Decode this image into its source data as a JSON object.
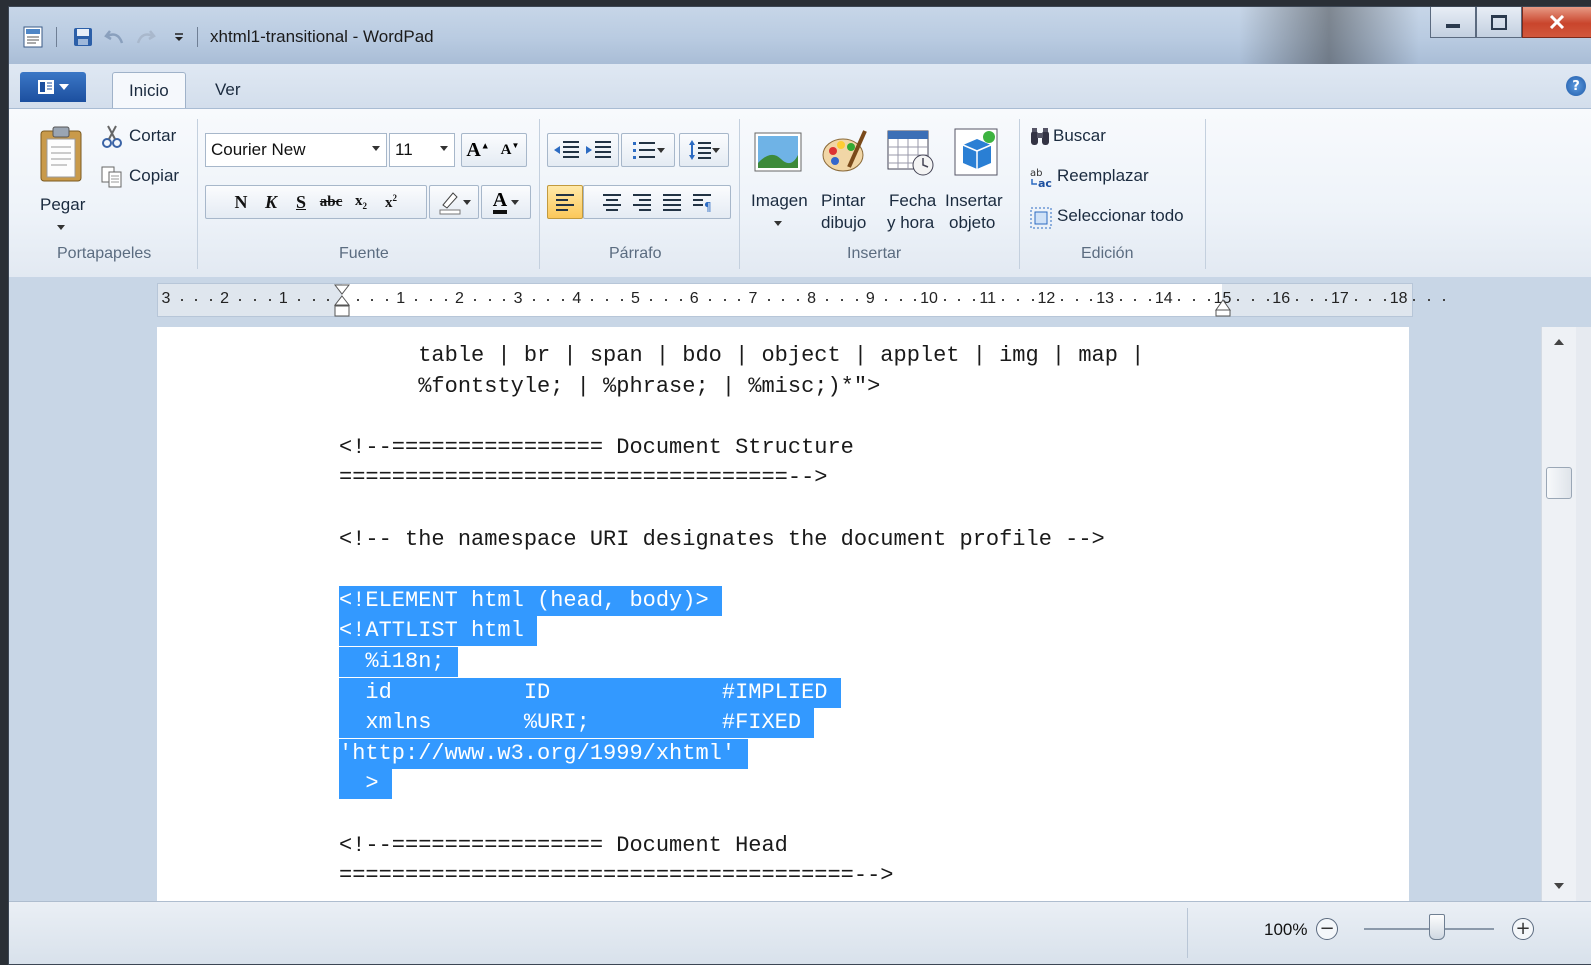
{
  "window": {
    "title": "xhtml1-transitional - WordPad"
  },
  "tabs": [
    {
      "label": "Inicio",
      "active": true
    },
    {
      "label": "Ver",
      "active": false
    }
  ],
  "ribbon": {
    "clipboard": {
      "paste_label": "Pegar",
      "cut_label": "Cortar",
      "copy_label": "Copiar",
      "group_label": "Portapapeles"
    },
    "font": {
      "family": "Courier New",
      "size": "11",
      "bold": "N",
      "italic": "K",
      "underline": "S",
      "group_label": "Fuente"
    },
    "paragraph": {
      "group_label": "Párrafo"
    },
    "insert": {
      "image_label": "Imagen",
      "paint_label_1": "Pintar",
      "paint_label_2": "dibujo",
      "datetime_label_1": "Fecha",
      "datetime_label_2": "y hora",
      "object_label_1": "Insertar",
      "object_label_2": "objeto",
      "group_label": "Insertar"
    },
    "editing": {
      "find_label": "Buscar",
      "replace_label": "Reemplazar",
      "select_all_label": "Seleccionar todo",
      "group_label": "Edición"
    }
  },
  "ruler": {
    "left_numbers": [
      "3",
      "2",
      "1"
    ],
    "right_numbers": [
      "1",
      "2",
      "3",
      "4",
      "5",
      "6",
      "7",
      "8",
      "9",
      "10",
      "11",
      "12",
      "13",
      "14",
      "15",
      "16",
      "17",
      "18"
    ]
  },
  "document": {
    "lines": [
      {
        "text": "      table | br | span | bdo | object | applet | img | map |",
        "selected": false
      },
      {
        "text": "      %fontstyle; | %phrase; | %misc;)*\">",
        "selected": false
      },
      {
        "text": "",
        "selected": false
      },
      {
        "text": "<!--================ Document Structure",
        "selected": false
      },
      {
        "text": "==================================-->",
        "selected": false
      },
      {
        "text": "",
        "selected": false
      },
      {
        "text": "<!-- the namespace URI designates the document profile -->",
        "selected": false
      },
      {
        "text": "",
        "selected": false
      },
      {
        "text": "<!ELEMENT html (head, body)> ",
        "selected": true
      },
      {
        "text": "<!ATTLIST html ",
        "selected": true
      },
      {
        "text": "  %i18n; ",
        "selected": true
      },
      {
        "text": "  id          ID             #IMPLIED ",
        "selected": true
      },
      {
        "text": "  xmlns       %URI;          #FIXED ",
        "selected": true
      },
      {
        "text": "'http://www.w3.org/1999/xhtml' ",
        "selected": true
      },
      {
        "text": "  > ",
        "selected": true
      },
      {
        "text": "",
        "selected": false
      },
      {
        "text": "<!--================ Document Head",
        "selected": false
      },
      {
        "text": "=======================================-->",
        "selected": false
      }
    ]
  },
  "status": {
    "zoom": "100%",
    "zoom_out": "−",
    "zoom_in": "+",
    "zoom_level": 0.55
  },
  "colors": {
    "selection": "#3399ff",
    "accent": "#1c4f9f"
  }
}
